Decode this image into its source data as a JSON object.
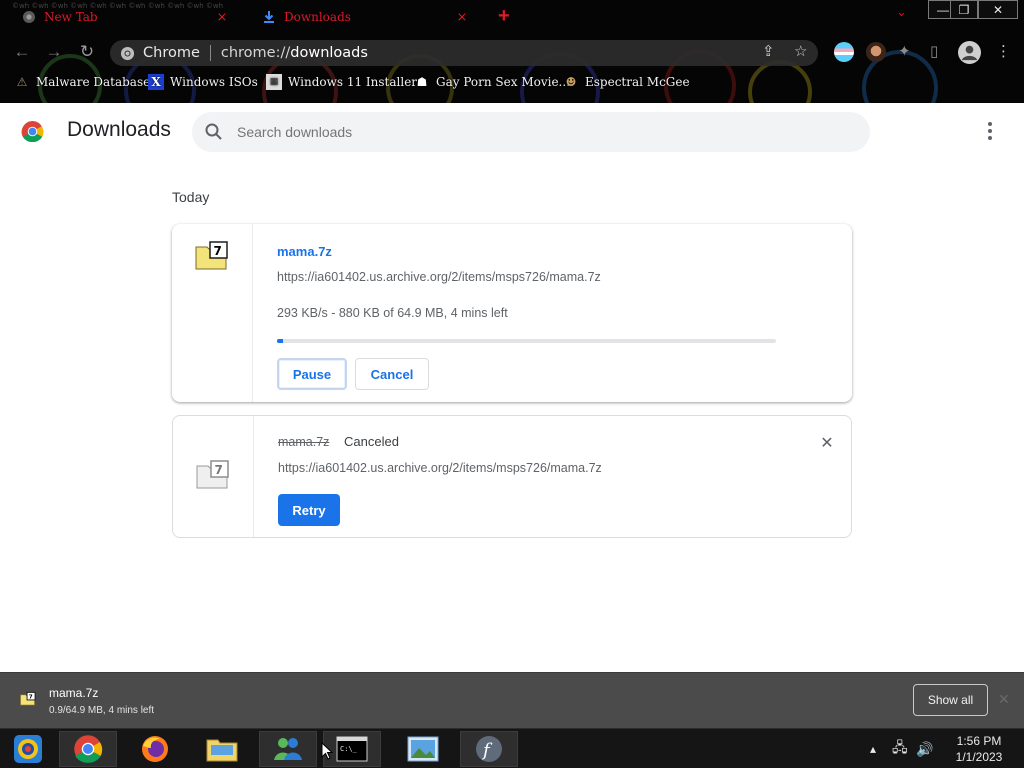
{
  "tabs": [
    {
      "title": "New Tab",
      "close_glyph": "×",
      "icon": "chrome-icon"
    },
    {
      "title": "Downloads",
      "close_glyph": "×",
      "icon": "download-icon"
    }
  ],
  "new_tab_glyph": "+",
  "window_controls": {
    "minimize": "—",
    "maximize": "❐",
    "close": "✕"
  },
  "omnibox": {
    "site": "Chrome",
    "url_prefix": "chrome://",
    "url_host": "downloads"
  },
  "bookmarks": [
    {
      "label": "Malware Database",
      "icon": "bookmark-icon"
    },
    {
      "label": "Windows ISOs",
      "icon": "x-icon"
    },
    {
      "label": "Windows 11 Installer",
      "icon": "image-icon"
    },
    {
      "label": "Gay Porn Sex Movie...",
      "icon": "figure-icon"
    },
    {
      "label": "Espectral McGee",
      "icon": "cat-icon"
    }
  ],
  "page": {
    "title": "Downloads",
    "search_placeholder": "Search downloads",
    "day_label": "Today"
  },
  "downloads": [
    {
      "file_name": "mama.7z",
      "url": "https://ia601402.us.archive.org/2/items/msps726/mama.7z",
      "status": "293 KB/s - 880 KB of 64.9 MB, 4 mins left",
      "progress": 0.013,
      "buttons": {
        "pause": "Pause",
        "cancel": "Cancel"
      }
    },
    {
      "file_name": "mama.7z",
      "state": "Canceled",
      "url": "https://ia601402.us.archive.org/2/items/msps726/mama.7z",
      "buttons": {
        "retry": "Retry"
      },
      "remove_glyph": "✕"
    }
  ],
  "shelf": {
    "item_name": "mama.7z",
    "item_status": "0.9/64.9 MB, 4 mins left",
    "show_all": "Show all"
  },
  "taskbar": {
    "apps": [
      "start-orb",
      "chrome",
      "firefox",
      "file-explorer",
      "messenger",
      "command-prompt",
      "photo-viewer",
      "flash"
    ],
    "time": "1:56 PM",
    "date": "1/1/2023"
  },
  "colors": {
    "accent": "#1a73e8",
    "tab_text": "#e0182a",
    "frame_bg": "#050505",
    "shelf_bg": "#4b4b4b",
    "taskbar_bg": "#151515"
  }
}
